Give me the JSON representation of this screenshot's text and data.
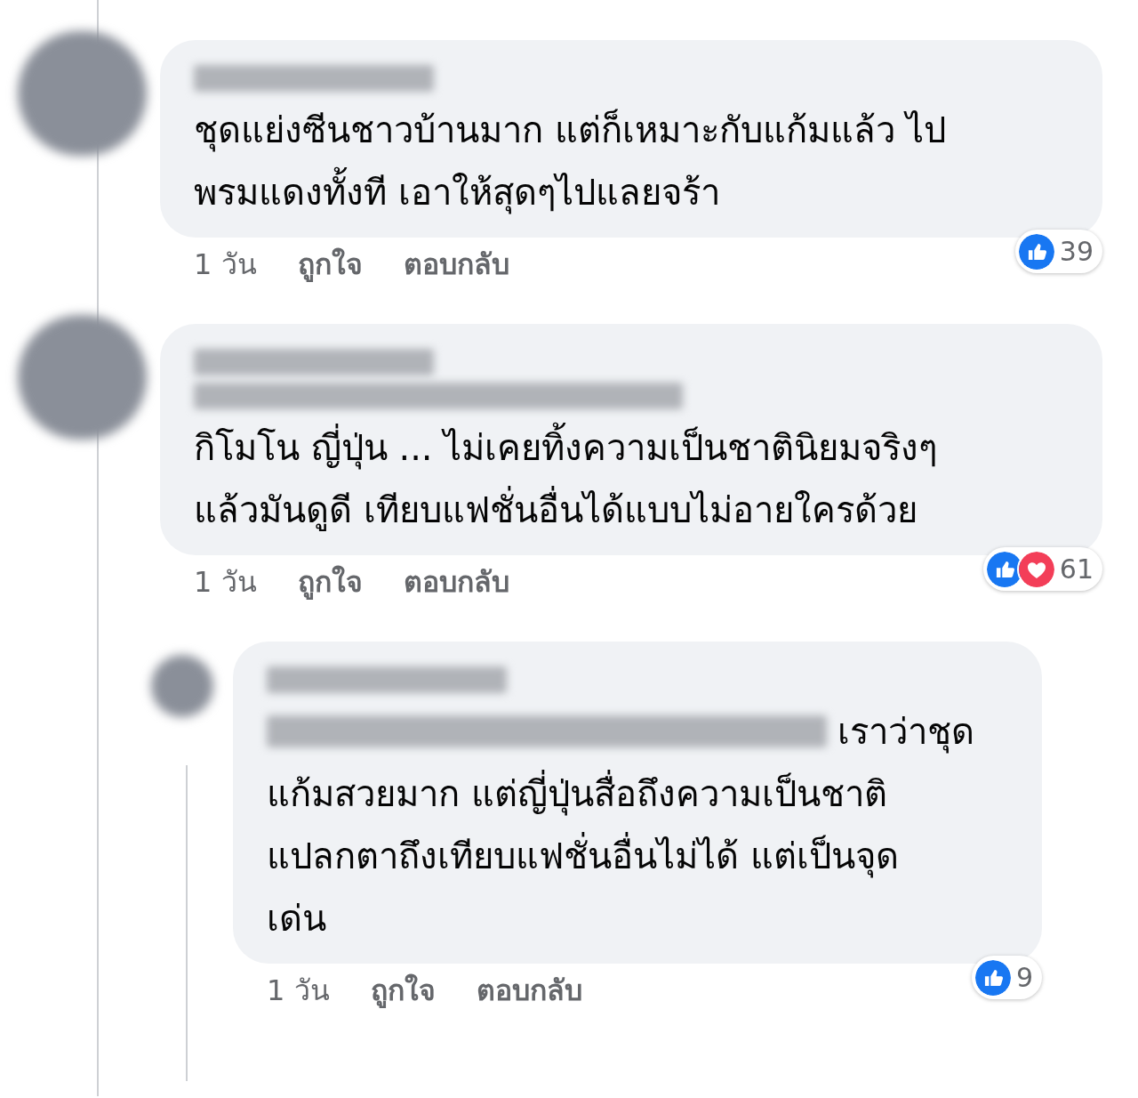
{
  "comments": [
    {
      "kind": "comment",
      "lines": [
        "ชุดแย่งซีนชาวบ้านมาก แต่ก็เหมาะกับแก้มแล้ว ไป",
        "พรมแดงทั้งที เอาให้สุดๆไปแลยจร้า"
      ],
      "time": "1 วัน",
      "like": "ถูกใจ",
      "reply": "ตอบกลับ",
      "reactions": [
        {
          "kind": "like"
        }
      ],
      "count": "39"
    },
    {
      "kind": "tagged_comment",
      "lines": [
        "กิโมโน ญี่ปุ่น ... ไม่เคยทิ้งความเป็นชาตินิยมจริงๆ",
        "แล้วมันดูดี เทียบแฟชั่นอื่นได้แบบไม่อายใครด้วย"
      ],
      "time": "1 วัน",
      "like": "ถูกใจ",
      "reply": "ตอบกลับ",
      "reactions": [
        {
          "kind": "like"
        },
        {
          "kind": "love"
        }
      ],
      "count": "61"
    },
    {
      "kind": "reply",
      "lines": [
        "เราว่าชุด",
        "แก้มสวยมาก แต่ญี่ปุ่นสื่อถึงความเป็นชาติ",
        "แปลกตาถึงเทียบแฟชั่นอื่นไม่ได้ แต่เป็นจุด",
        "เด่น"
      ],
      "time": "1 วัน",
      "like": "ถูกใจ",
      "reply": "ตอบกลับ",
      "reactions": [
        {
          "kind": "like"
        }
      ],
      "count": "9"
    }
  ]
}
